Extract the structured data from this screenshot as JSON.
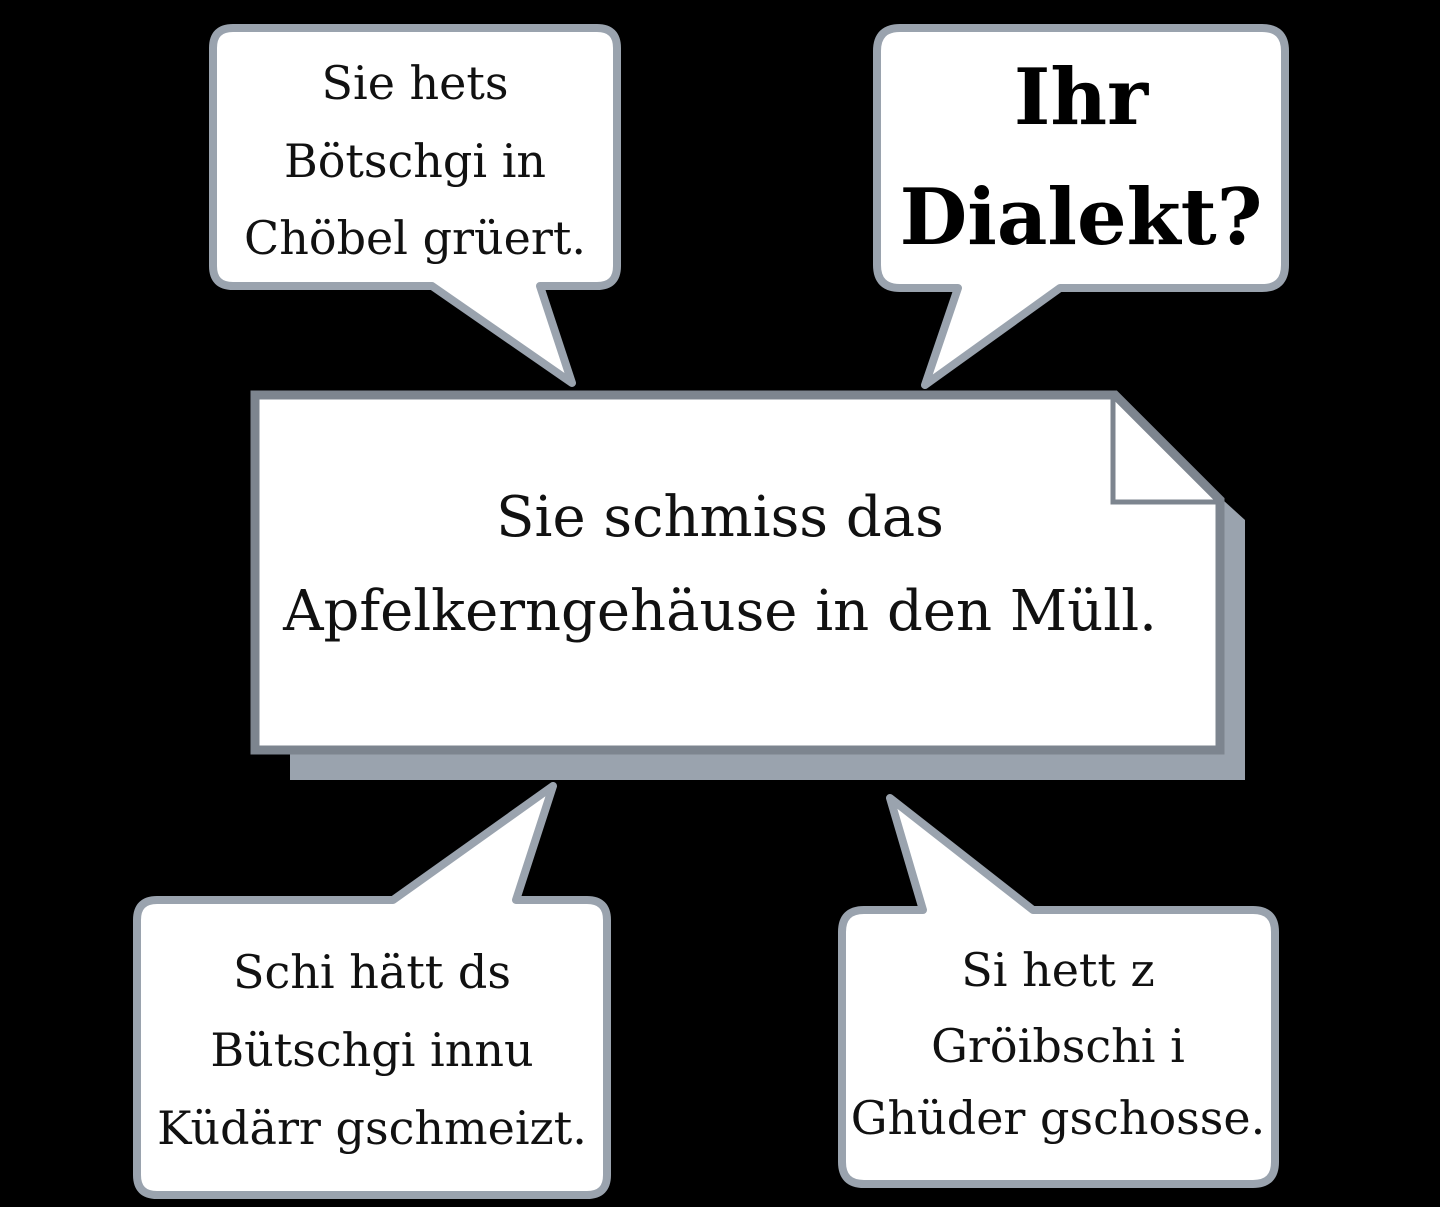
{
  "center_note": {
    "lines": [
      "Sie schmiss das",
      "Apfelkerngehäuse in den Müll."
    ]
  },
  "bubbles": {
    "top_left": {
      "lines": [
        "Sie hets",
        "Bötschgi in",
        "Chöbel grüert."
      ]
    },
    "top_right": {
      "lines": [
        "Ihr",
        "Dialekt?"
      ]
    },
    "bottom_left": {
      "lines": [
        "Schi hätt ds",
        "Bütschgi innu",
        "Küdärr gschmeizt."
      ]
    },
    "bottom_right": {
      "lines": [
        "Si hett z",
        "Gröibschi i",
        "Ghüder gschosse."
      ]
    }
  },
  "colors": {
    "background": "#000000",
    "bubble_fill": "#ffffff",
    "bubble_border": "#9aa3ae",
    "note_border": "#7d858f",
    "note_shadow": "#9aa3ae",
    "text": "#111111"
  }
}
